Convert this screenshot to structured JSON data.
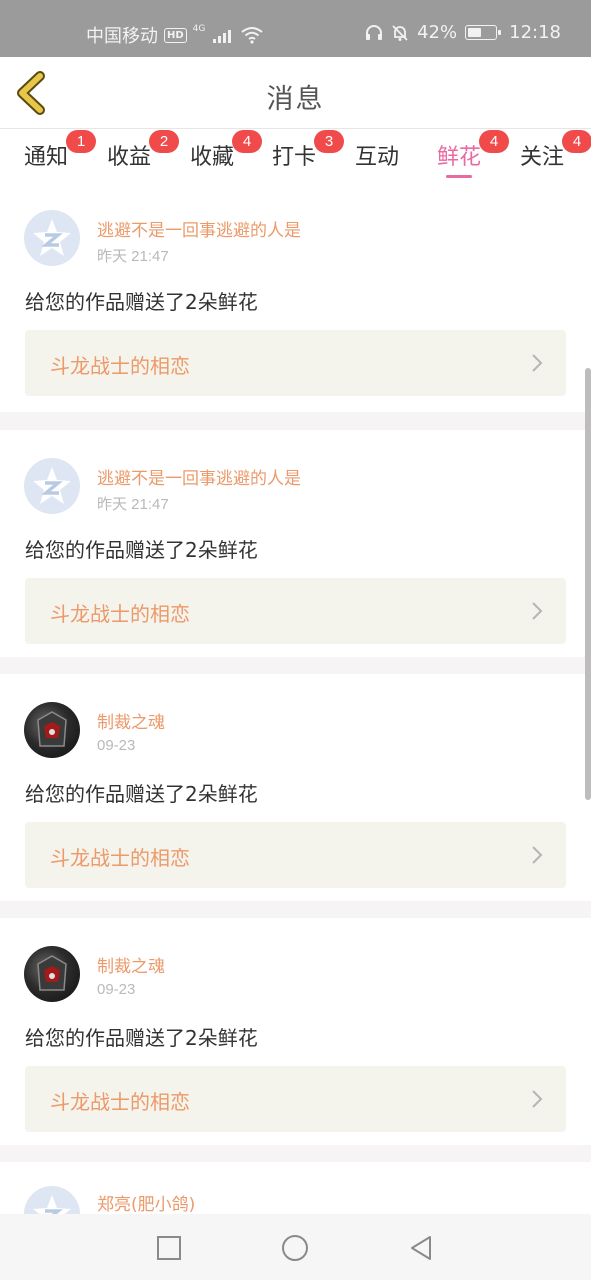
{
  "status_bar": {
    "carrier": "中国移动",
    "hd": "HD",
    "network": "4G",
    "battery": "42%",
    "battery_level": 0.42,
    "time": "12:18"
  },
  "header": {
    "title": "消息"
  },
  "tabs": [
    {
      "label": "通知",
      "badge": "1"
    },
    {
      "label": "收益",
      "badge": "2"
    },
    {
      "label": "收藏",
      "badge": "4"
    },
    {
      "label": "打卡",
      "badge": "3"
    },
    {
      "label": "互动",
      "badge": ""
    },
    {
      "label": "鲜花",
      "badge": "4",
      "active": true
    },
    {
      "label": "关注",
      "badge": "4"
    }
  ],
  "messages": [
    {
      "user": "逃避不是一回事逃避的人是",
      "time": "昨天 21:47",
      "text": "给您的作品赠送了2朵鲜花",
      "work": "斗龙战士的相恋",
      "avatar": "default-logo"
    },
    {
      "user": "逃避不是一回事逃避的人是",
      "time": "昨天 21:47",
      "text": "给您的作品赠送了2朵鲜花",
      "work": "斗龙战士的相恋",
      "avatar": "default-logo"
    },
    {
      "user": "制裁之魂",
      "time": "09-23",
      "text": "给您的作品赠送了2朵鲜花",
      "work": "斗龙战士的相恋",
      "avatar": "photo"
    },
    {
      "user": "制裁之魂",
      "time": "09-23",
      "text": "给您的作品赠送了2朵鲜花",
      "work": "斗龙战士的相恋",
      "avatar": "photo"
    },
    {
      "user": "郑亮(肥小鸽)",
      "time": "",
      "text": "",
      "work": "",
      "avatar": "default-logo"
    }
  ],
  "colors": {
    "accent": "#e96aa3",
    "username": "#ec9a6a",
    "badge": "#f04a4a",
    "back_arrow": "#e8c64a"
  },
  "navbar": {
    "icons": [
      "square-icon",
      "circle-icon",
      "triangle-back-icon"
    ]
  }
}
